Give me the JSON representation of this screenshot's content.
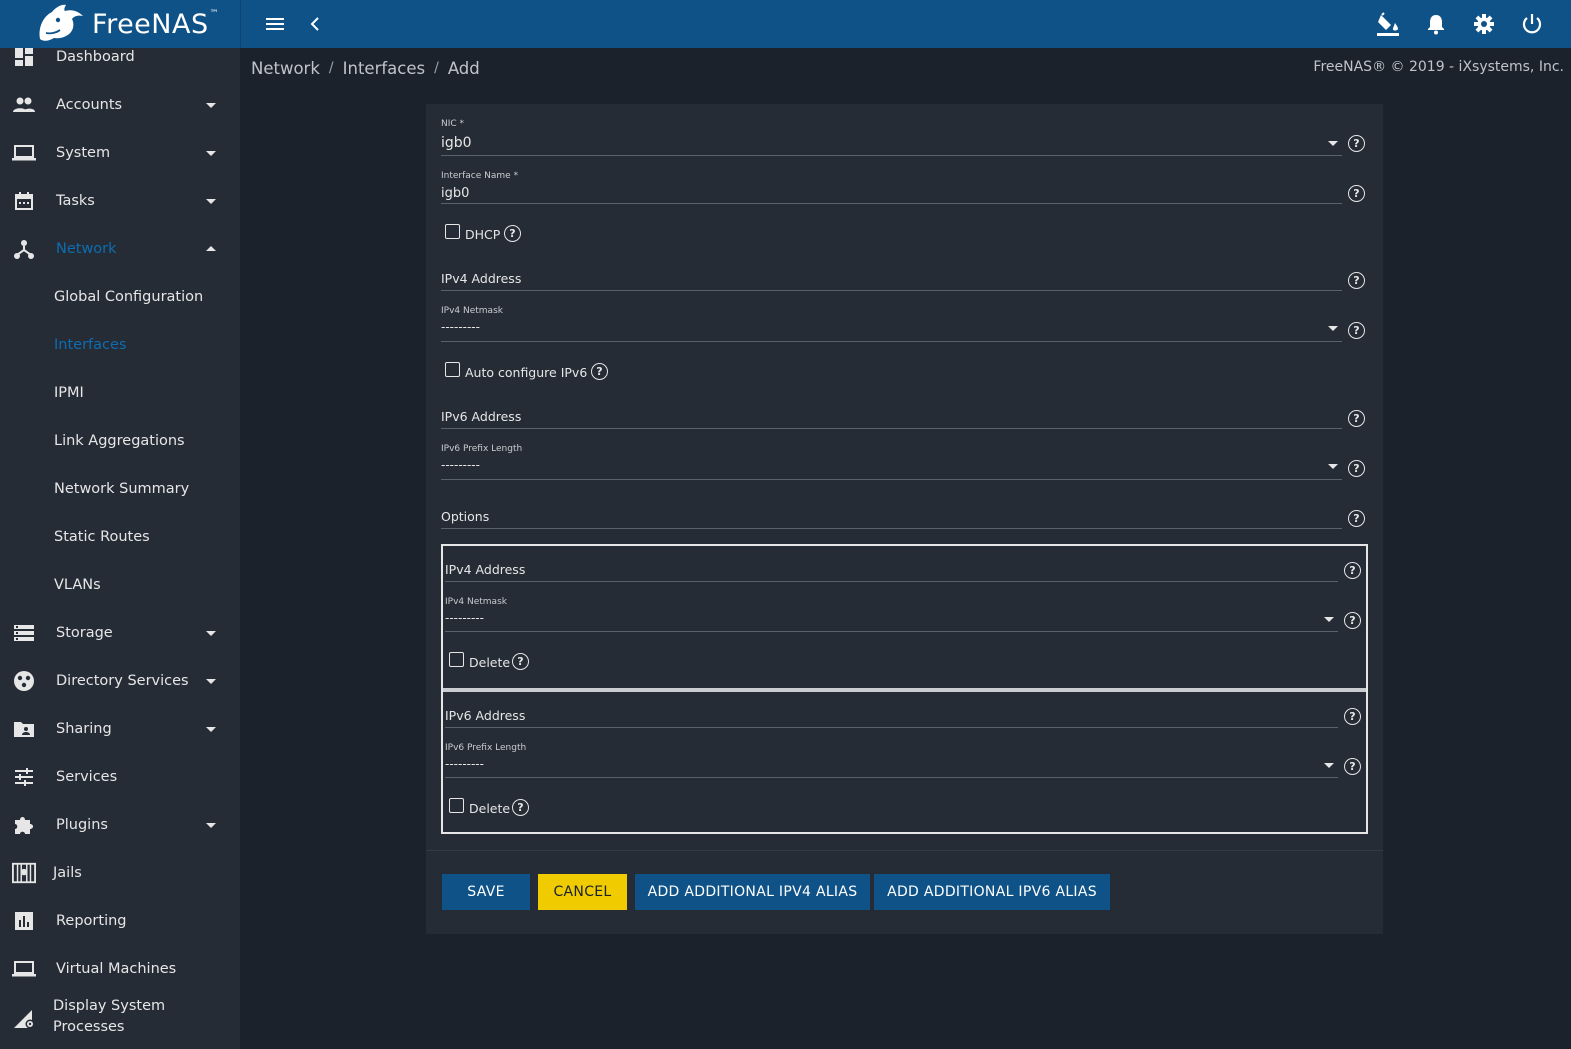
{
  "app": {
    "brand": "FreeNAS",
    "brand_mark": "™",
    "copyright": "FreeNAS® © 2019 - iXsystems, Inc."
  },
  "topbar": {
    "icons": [
      "menu-icon",
      "back-chevron-icon",
      "theme-bucket-icon",
      "bell-icon",
      "gear-icon",
      "power-icon"
    ]
  },
  "sidebar": {
    "items": [
      {
        "label": "Dashboard",
        "icon": "dashboard-icon"
      },
      {
        "label": "Accounts",
        "icon": "people-icon"
      },
      {
        "label": "System",
        "icon": "laptop-icon"
      },
      {
        "label": "Tasks",
        "icon": "calendar-icon"
      },
      {
        "label": "Network",
        "icon": "network-icon"
      },
      {
        "label": "Storage",
        "icon": "storage-icon"
      },
      {
        "label": "Directory Services",
        "icon": "directory-icon"
      },
      {
        "label": "Sharing",
        "icon": "folder-share-icon"
      },
      {
        "label": "Services",
        "icon": "sliders-icon"
      },
      {
        "label": "Plugins",
        "icon": "puzzle-icon"
      },
      {
        "label": "Jails",
        "icon": "jail-icon"
      },
      {
        "label": "Reporting",
        "icon": "chart-icon"
      },
      {
        "label": "Virtual Machines",
        "icon": "laptop-icon"
      },
      {
        "label": "Display System Processes",
        "label_line1": "Display System",
        "label_line2": "Processes",
        "icon": "processes-icon"
      }
    ],
    "network_sub": [
      {
        "label": "Global Configuration"
      },
      {
        "label": "Interfaces"
      },
      {
        "label": "IPMI"
      },
      {
        "label": "Link Aggregations"
      },
      {
        "label": "Network Summary"
      },
      {
        "label": "Static Routes"
      },
      {
        "label": "VLANs"
      }
    ]
  },
  "breadcrumb": {
    "items": [
      "Network",
      "Interfaces",
      "Add"
    ],
    "separator": "/"
  },
  "form": {
    "nic": {
      "label": "NIC *",
      "value": "igb0"
    },
    "interface_name": {
      "label": "Interface Name *",
      "value": "igb0"
    },
    "dhcp": {
      "label": "DHCP",
      "checked": false
    },
    "ipv4_address": {
      "placeholder": "IPv4 Address"
    },
    "ipv4_netmask": {
      "label": "IPv4 Netmask",
      "value": "---------"
    },
    "auto_ipv6": {
      "label": "Auto configure IPv6",
      "checked": false
    },
    "ipv6_address": {
      "placeholder": "IPv6 Address"
    },
    "ipv6_prefix": {
      "label": "IPv6 Prefix Length",
      "value": "---------"
    },
    "options": {
      "placeholder": "Options"
    },
    "alias_v4": {
      "address_placeholder": "IPv4 Address",
      "netmask_label": "IPv4 Netmask",
      "netmask_value": "---------",
      "delete_label": "Delete"
    },
    "alias_v6": {
      "address_placeholder": "IPv6 Address",
      "prefix_label": "IPv6 Prefix Length",
      "prefix_value": "---------",
      "delete_label": "Delete"
    },
    "help_glyph": "?",
    "buttons": {
      "save": "SAVE",
      "cancel": "CANCEL",
      "add_ipv4": "ADD ADDITIONAL IPV4 ALIAS",
      "add_ipv6": "ADD ADDITIONAL IPV6 ALIAS"
    }
  },
  "colors": {
    "topbar": "#0e5287",
    "sidebar": "#252c36",
    "background": "#1b222b",
    "active": "#0e6db0",
    "primary_button": "#0e5287",
    "warn_button": "#f0cb00"
  }
}
